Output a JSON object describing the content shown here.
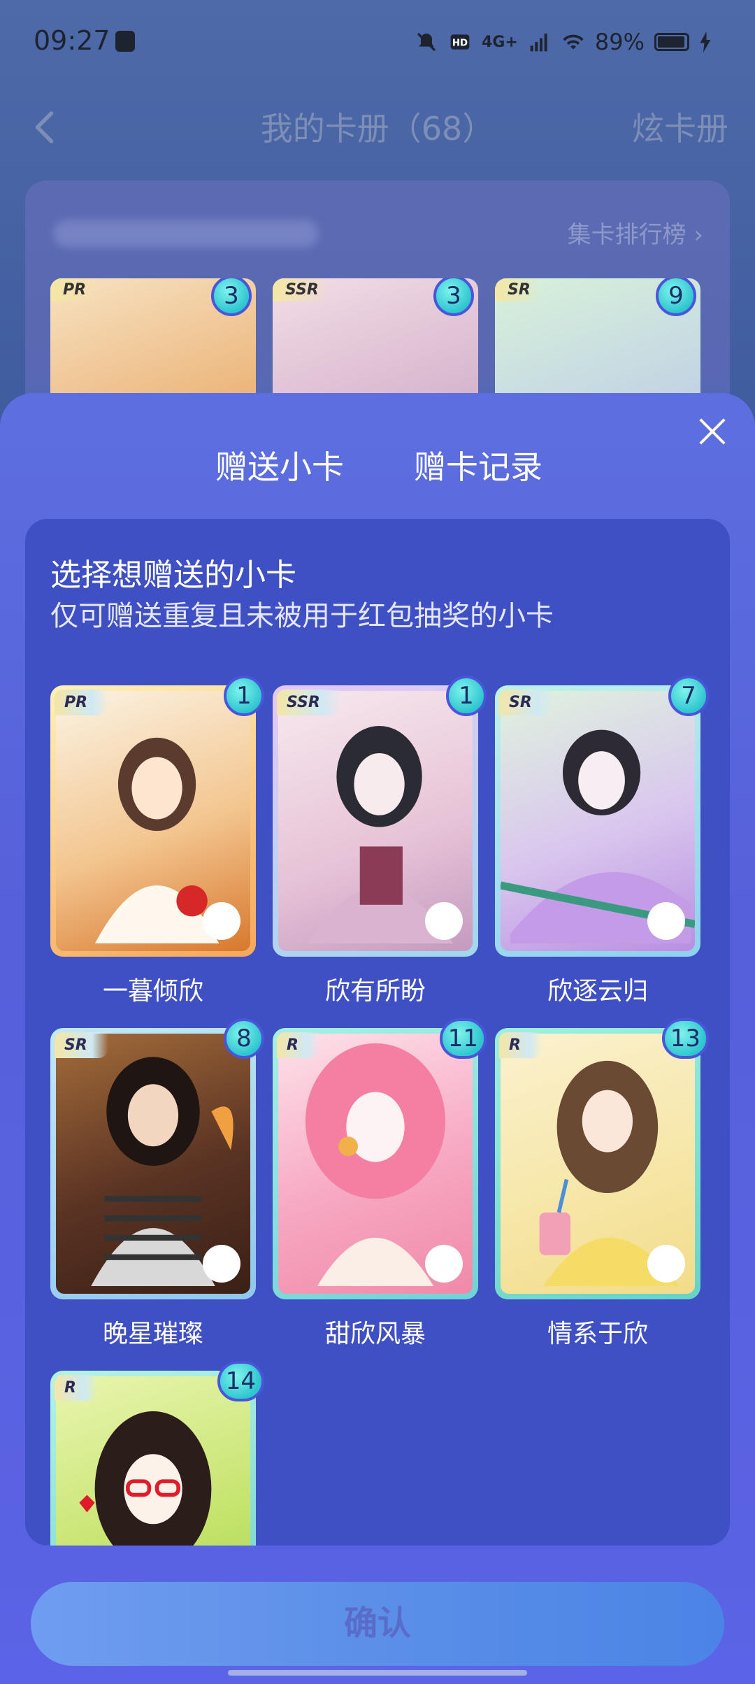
{
  "status_bar": {
    "time": "09:27",
    "network": "4G+",
    "battery": "89%"
  },
  "header": {
    "title": "我的卡册（68）",
    "action": "炫卡册"
  },
  "album": {
    "ranking_link": "集卡排行榜",
    "preview_cards": [
      {
        "rarity": "PR",
        "count": "3"
      },
      {
        "rarity": "SSR",
        "count": "3"
      },
      {
        "rarity": "SR",
        "count": "9"
      }
    ]
  },
  "sheet": {
    "tabs": [
      {
        "label": "赠送小卡"
      },
      {
        "label": "赠卡记录"
      }
    ],
    "heading": "选择想赠送的小卡",
    "subheading": "仅可赠送重复且未被用于红包抽奖的小卡",
    "cards": [
      {
        "name": "一暮倾欣",
        "rarity": "PR",
        "count": "1",
        "frame": "#f5b45a",
        "bg": "#f2c080"
      },
      {
        "name": "欣有所盼",
        "rarity": "SSR",
        "count": "1",
        "frame": "#c9b8f0",
        "bg": "#efdbe9"
      },
      {
        "name": "欣逐云归",
        "rarity": "SR",
        "count": "7",
        "frame": "#8ee0e6",
        "bg": "#d7f0dc"
      },
      {
        "name": "晚星璀璨",
        "rarity": "SR",
        "count": "8",
        "frame": "#8fd2ee",
        "bg": "#6b4a3a"
      },
      {
        "name": "甜欣风暴",
        "rarity": "R",
        "count": "11",
        "frame": "#74d9d3",
        "bg": "#f6a3c0"
      },
      {
        "name": "情系于欣",
        "rarity": "R",
        "count": "13",
        "frame": "#6fd8cf",
        "bg": "#f7ecc4"
      },
      {
        "name": "",
        "rarity": "R",
        "count": "14",
        "frame": "#79d7cd",
        "bg": "#c6e46e"
      }
    ],
    "confirm_label": "确认"
  },
  "colors": {
    "sheet_bg": "#5a63e2",
    "panel_bg": "#3f4fc4",
    "badge": "#3fd0d6",
    "confirm": "#5b8fe8"
  }
}
